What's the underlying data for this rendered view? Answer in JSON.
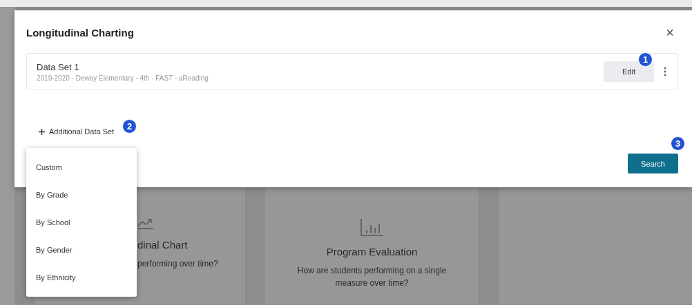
{
  "background_cards": [
    {
      "kind": "trend",
      "title": "dinal Chart",
      "description": "performing over time?"
    },
    {
      "kind": "bars",
      "title": "Program Evaluation",
      "description": "How are students performing on a single measure over time?"
    },
    {
      "kind": "empty"
    }
  ],
  "dialog": {
    "title": "Longitudinal Charting",
    "close": "×",
    "data_sets": [
      {
        "name": "Data Set 1",
        "details": "2019-2020 - Dewey Elementary - 4th - FAST - aReading",
        "edit": "Edit"
      }
    ],
    "add_button": "Additional Data Set",
    "search_button": "Search"
  },
  "menu": {
    "items": [
      "Custom",
      "By Grade",
      "By School",
      "By Gender",
      "By Ethnicity"
    ]
  },
  "callouts": [
    "1",
    "2",
    "3"
  ]
}
